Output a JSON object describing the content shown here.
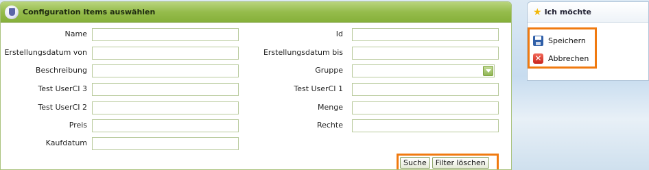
{
  "panel": {
    "title": "Configuration Items auswählen"
  },
  "form": {
    "name_label": "Name",
    "id_label": "Id",
    "created_from_label": "Erstellungsdatum von",
    "created_to_label": "Erstellungsdatum bis",
    "description_label": "Beschreibung",
    "group_label": "Gruppe",
    "test_userci3_label": "Test UserCI 3",
    "test_userci1_label": "Test UserCI 1",
    "test_userci2_label": "Test UserCI 2",
    "quantity_label": "Menge",
    "price_label": "Preis",
    "rights_label": "Rechte",
    "purchase_date_label": "Kaufdatum",
    "search_button": "Suche",
    "clear_filter_button": "Filter löschen"
  },
  "sidebar": {
    "title": "Ich möchte",
    "save_label": "Speichern",
    "cancel_label": "Abbrechen"
  },
  "colors": {
    "header_green": "#95bc4c",
    "highlight_orange": "#f07a10"
  },
  "icons": [
    "config-items-icon",
    "star-icon",
    "save-icon",
    "cancel-icon",
    "chevron-down-icon"
  ]
}
